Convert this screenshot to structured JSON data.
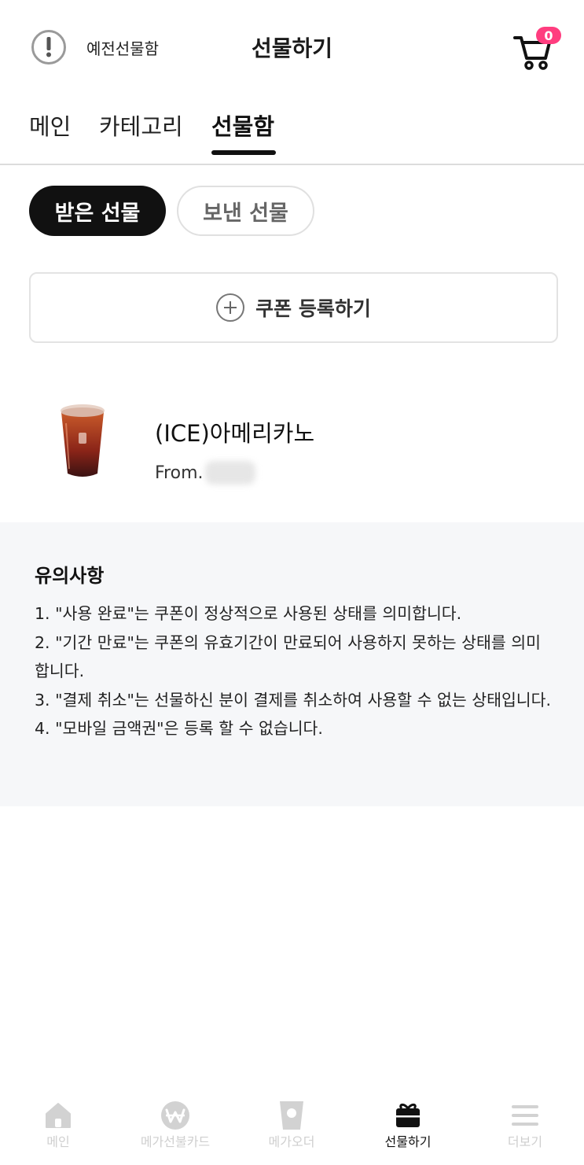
{
  "header": {
    "old_gift_label": "예전선물함",
    "title": "선물하기",
    "cart_count": "0"
  },
  "tabs": [
    {
      "label": "메인",
      "active": false
    },
    {
      "label": "카테고리",
      "active": false
    },
    {
      "label": "선물함",
      "active": true
    }
  ],
  "segments": {
    "received": "받은 선물",
    "sent": "보낸 선물"
  },
  "coupon": {
    "register_label": "쿠폰 등록하기"
  },
  "gift": {
    "name": "(ICE)아메리카노",
    "from_label": "From."
  },
  "notice": {
    "title": "유의사항",
    "items": [
      "1. \"사용 완료\"는 쿠폰이 정상적으로 사용된 상태를 의미합니다.",
      "2. \"기간 만료\"는 쿠폰의 유효기간이 만료되어 사용하지 못하는 상태를 의미합니다.",
      "3. \"결제 취소\"는 선물하신 분이 결제를 취소하여 사용할 수 없는 상태입니다.",
      "4. \"모바일 금액권\"은 등록 할 수 없습니다."
    ]
  },
  "bottom_nav": [
    {
      "label": "메인",
      "icon": "home-icon",
      "active": false
    },
    {
      "label": "메가선불카드",
      "icon": "won-card-icon",
      "active": false
    },
    {
      "label": "메가오더",
      "icon": "cup-icon",
      "active": false
    },
    {
      "label": "선물하기",
      "icon": "gift-icon",
      "active": true
    },
    {
      "label": "더보기",
      "icon": "menu-icon",
      "active": false
    }
  ],
  "colors": {
    "badge": "#ff3d7f",
    "active": "#111111",
    "inactive": "#cfcfcf",
    "notice_bg": "#f6f7f9"
  }
}
